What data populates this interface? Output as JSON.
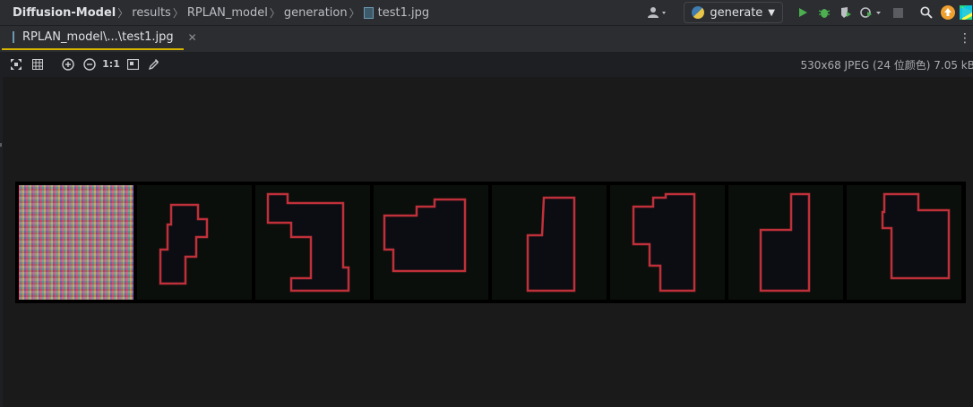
{
  "breadcrumbs": [
    {
      "label": "Diffusion-Model"
    },
    {
      "label": "results"
    },
    {
      "label": "RPLAN_model"
    },
    {
      "label": "generation"
    },
    {
      "label": "test1.jpg"
    }
  ],
  "run_config": {
    "label": "generate"
  },
  "editor_tab": {
    "label": "RPLAN_model\\...\\test1.jpg"
  },
  "image_toolbar": {
    "one_to_one_label": "1:1",
    "info": "530x68 JPEG (24 位颜色) 7.05 kB"
  },
  "image_preview": {
    "panels": [
      "noise",
      "floorplan",
      "floorplan",
      "floorplan",
      "floorplan",
      "floorplan",
      "floorplan",
      "floorplan"
    ]
  },
  "colors": {
    "accent_tab_underline": "#d6b400",
    "outline_red": "#c0303a",
    "run_green": "#4caf50"
  }
}
